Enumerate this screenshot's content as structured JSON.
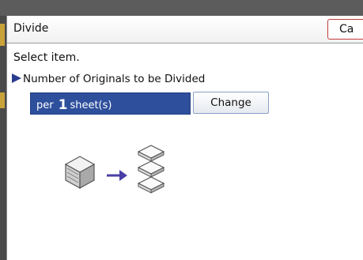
{
  "dialog": {
    "title": "Divide",
    "cancel_label": "Ca"
  },
  "main": {
    "instruction": "Select item.",
    "section_label": "Number of Originals to be Divided",
    "value_prefix": "per",
    "value_number": "1",
    "value_unit": "sheet(s)",
    "change_label": "Change"
  },
  "colors": {
    "accent_blue": "#2e4f9c",
    "cancel_border": "#c43b3b",
    "arrow": "#4a3fa6"
  },
  "icons": {
    "illustration_source": "stacked-originals-icon",
    "illustration_arrow": "right-arrow-icon",
    "illustration_result": "divided-sets-icon"
  }
}
